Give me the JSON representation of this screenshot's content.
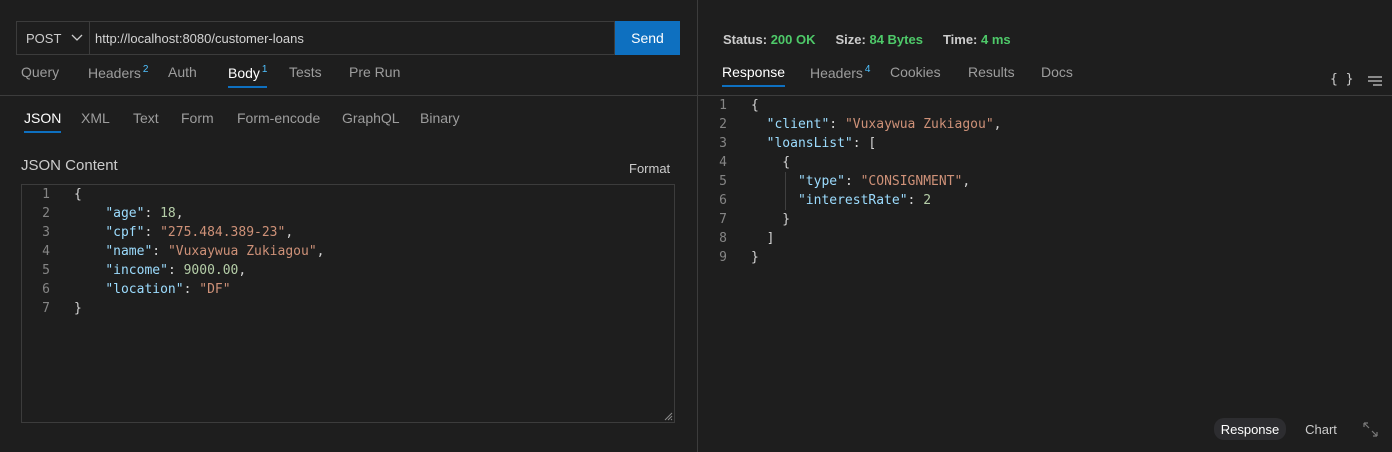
{
  "request": {
    "method": "POST",
    "url": "http://localhost:8080/customer-loans",
    "send_label": "Send"
  },
  "request_tabs": [
    {
      "label": "Query",
      "badge": ""
    },
    {
      "label": "Headers",
      "badge": "2"
    },
    {
      "label": "Auth",
      "badge": ""
    },
    {
      "label": "Body",
      "badge": "1",
      "active": true
    },
    {
      "label": "Tests",
      "badge": ""
    },
    {
      "label": "Pre Run",
      "badge": ""
    }
  ],
  "body_tabs": [
    "JSON",
    "XML",
    "Text",
    "Form",
    "Form-encode",
    "GraphQL",
    "Binary"
  ],
  "body_active": "JSON",
  "json_content_label": "JSON Content",
  "format_label": "Format",
  "request_body_lines": [
    "{",
    "    \"age\": 18,",
    "    \"cpf\": \"275.484.389-23\",",
    "    \"name\": \"Vuxaywua Zukiagou\",",
    "    \"income\": 9000.00,",
    "    \"location\": \"DF\"",
    "}"
  ],
  "status": {
    "status_label": "Status:",
    "status_value": "200 OK",
    "size_label": "Size:",
    "size_value": "84 Bytes",
    "time_label": "Time:",
    "time_value": "4 ms"
  },
  "response_tabs": [
    {
      "label": "Response",
      "badge": "",
      "active": true
    },
    {
      "label": "Headers",
      "badge": "4"
    },
    {
      "label": "Cookies",
      "badge": ""
    },
    {
      "label": "Results",
      "badge": ""
    },
    {
      "label": "Docs",
      "badge": ""
    }
  ],
  "braces_icon_text": "{ }",
  "response_lines": [
    "{",
    "  \"client\": \"Vuxaywua Zukiagou\",",
    "  \"loansList\": [",
    "    {",
    "      \"type\": \"CONSIGNMENT\",",
    "      \"interestRate\": 2",
    "    }",
    "  ]",
    "}"
  ],
  "bottom_buttons": {
    "response": "Response",
    "chart": "Chart"
  },
  "colors": {
    "accent": "#0e70c0",
    "status_ok": "#4ec969",
    "json_key": "#9cdcfe",
    "json_string": "#ce9178",
    "json_number": "#b5cea8"
  }
}
